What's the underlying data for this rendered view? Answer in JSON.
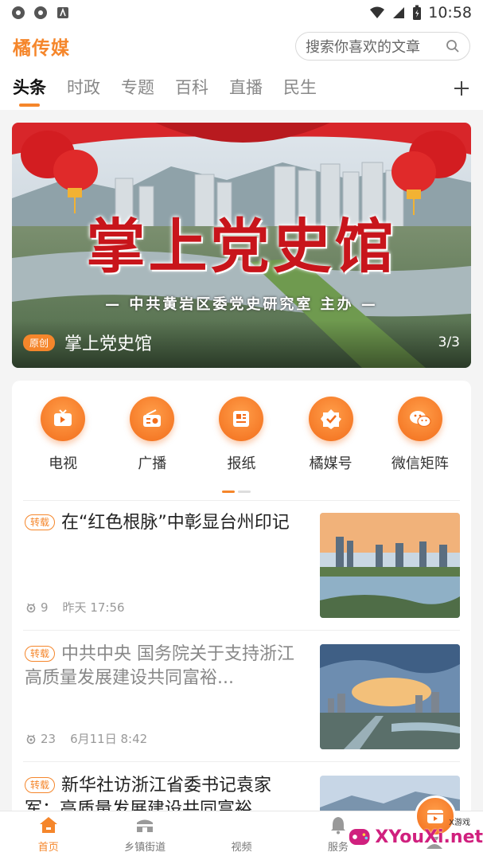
{
  "status_bar": {
    "time": "10:58",
    "icons": [
      "app-icon",
      "app-icon",
      "notification-icon",
      "wifi-icon",
      "signal-icon",
      "battery-icon"
    ]
  },
  "header": {
    "app_title": "橘传媒",
    "search_placeholder": "搜索你喜欢的文章"
  },
  "tabs": {
    "items": [
      {
        "label": "头条",
        "active": true
      },
      {
        "label": "时政",
        "active": false
      },
      {
        "label": "专题",
        "active": false
      },
      {
        "label": "百科",
        "active": false
      },
      {
        "label": "直播",
        "active": false
      },
      {
        "label": "民生",
        "active": false
      }
    ],
    "add_icon": "plus-icon"
  },
  "banner": {
    "heading": "掌上党史馆",
    "subheading": "— 中共黄岩区委党史研究室 主办 —",
    "badge": "原创",
    "caption": "掌上党史馆",
    "index": "3/3"
  },
  "quick_links": [
    {
      "label": "电视",
      "icon": "tv-icon"
    },
    {
      "label": "广播",
      "icon": "radio-icon"
    },
    {
      "label": "报纸",
      "icon": "newspaper-icon"
    },
    {
      "label": "橘媒号",
      "icon": "verified-icon"
    },
    {
      "label": "微信矩阵",
      "icon": "wechat-icon"
    }
  ],
  "quick_pager": {
    "pages": 2,
    "active": 0
  },
  "news": [
    {
      "tag": "转载",
      "title": "在“红色根脉”中彰显台州印记",
      "views": "9",
      "time": "昨天 17:56",
      "read": false
    },
    {
      "tag": "转载",
      "title": "中共中央 国务院关于支持浙江高质量发展建设共同富裕...",
      "views": "23",
      "time": "6月11日 8:42",
      "read": true
    },
    {
      "tag": "转载",
      "title": "新华社访浙江省委书记袁家军：高质量发展建设共同富裕",
      "views": "",
      "time": "",
      "read": false
    }
  ],
  "bottom_nav": [
    {
      "label": "首页",
      "icon": "home-icon",
      "active": true
    },
    {
      "label": "乡镇街道",
      "icon": "town-icon",
      "active": false
    },
    {
      "label": "视频",
      "icon": "video-icon",
      "active": false
    },
    {
      "label": "服务",
      "icon": "bell-icon",
      "active": false
    },
    {
      "label": "",
      "icon": "user-icon",
      "active": false
    }
  ],
  "watermark": {
    "text": "XYouXi.net",
    "small": "X游戏"
  },
  "colors": {
    "accent": "#f5862b",
    "banner_red": "#c8151b"
  }
}
